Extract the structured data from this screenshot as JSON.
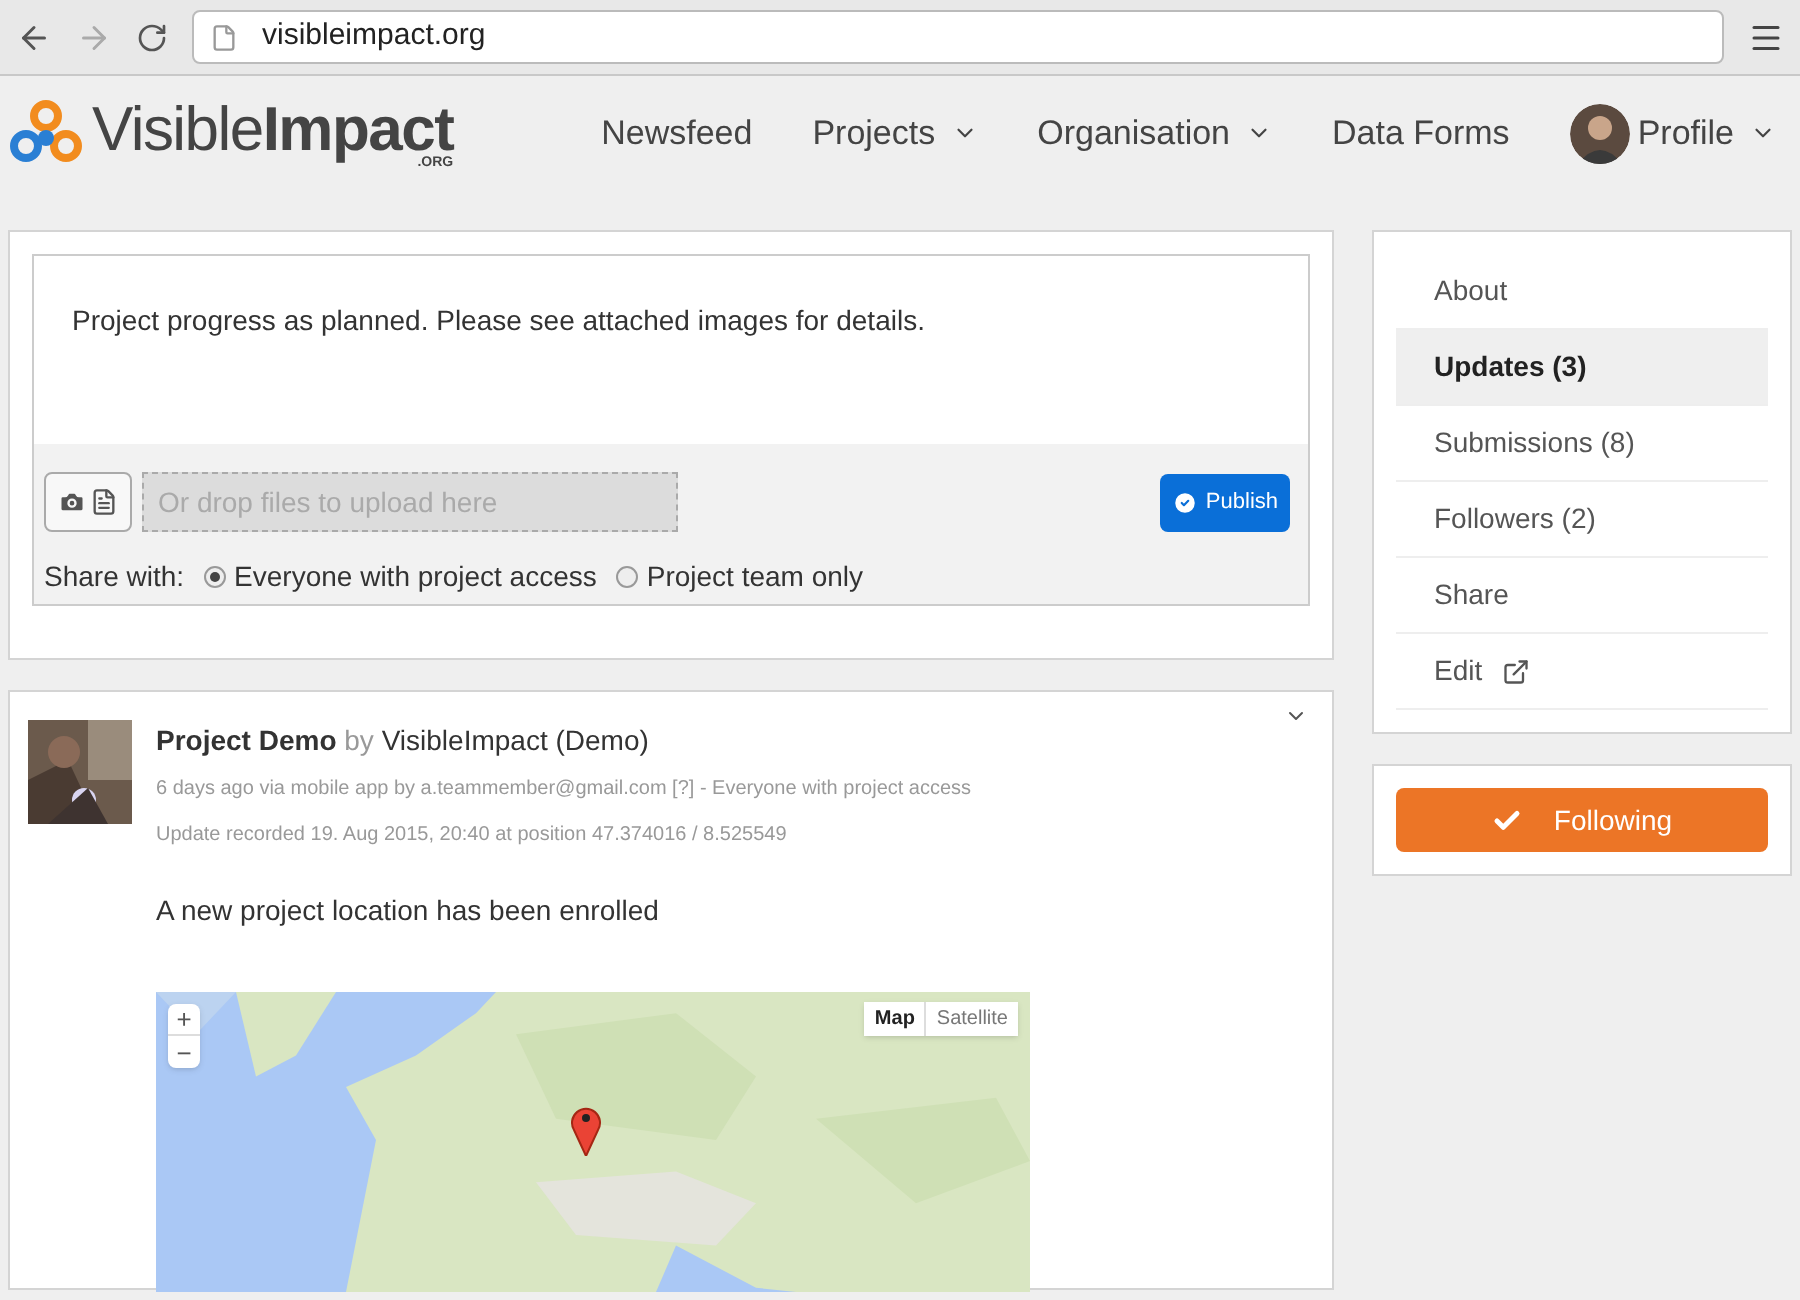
{
  "browser": {
    "url": "visibleimpact.org"
  },
  "header": {
    "logo": {
      "word_light": "Visible",
      "word_bold": "Impact",
      "suffix": ".ORG"
    },
    "nav": [
      {
        "label": "Newsfeed",
        "dropdown": false
      },
      {
        "label": "Projects",
        "dropdown": true
      },
      {
        "label": "Organisation",
        "dropdown": true
      },
      {
        "label": "Data Forms",
        "dropdown": false
      },
      {
        "label": "Profile",
        "dropdown": true,
        "kind": "avatar"
      }
    ]
  },
  "composer": {
    "text": "Project progress as planned. Please see attached images for details.",
    "upload_placeholder": "Or drop files to upload here",
    "publish": "Publish",
    "share_label": "Share with:",
    "share_options": [
      {
        "label": "Everyone with project access",
        "selected": true
      },
      {
        "label": "Project team only",
        "selected": false
      }
    ]
  },
  "post": {
    "project": "Project Demo",
    "by": "by",
    "author": "VisibleImpact (Demo)",
    "meta": "6 days ago via mobile app by a.teammember@gmail.com [?] - Everyone with project access",
    "recorded": "Update recorded 19. Aug 2015, 20:40 at position 47.374016 / 8.525549",
    "body": "A new project location has been enrolled",
    "map": {
      "kind": "picture",
      "zoom_in": "+",
      "zoom_out": "−",
      "types": [
        {
          "label": "Map",
          "selected": true
        },
        {
          "label": "Satellite",
          "selected": false
        }
      ]
    }
  },
  "sidebar": {
    "items": [
      {
        "label": "About",
        "selected": false
      },
      {
        "label": "Updates (3)",
        "selected": true
      },
      {
        "label": "Submissions (8)",
        "selected": false
      },
      {
        "label": "Followers (2)",
        "selected": false
      },
      {
        "label": "Share",
        "selected": false
      },
      {
        "label": "Edit",
        "selected": false,
        "external": true
      }
    ],
    "follow_button": "Following"
  }
}
